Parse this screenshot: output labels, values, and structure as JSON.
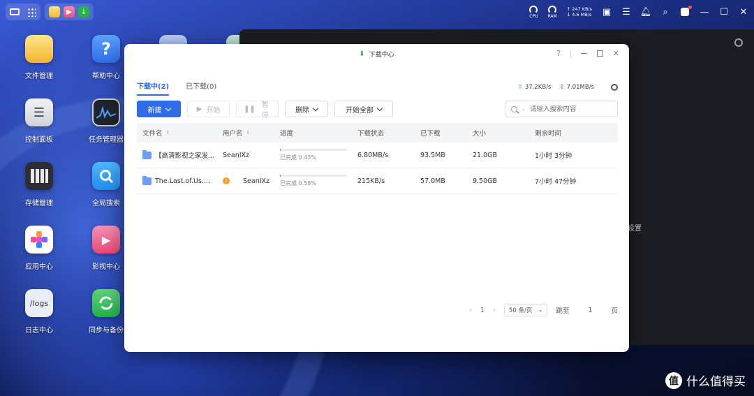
{
  "window": {
    "title": "下载中心",
    "help": "?",
    "close": "✕"
  },
  "tabs": [
    {
      "label": "下载中心(2)"
    },
    {
      "label": "已下载(0)"
    }
  ],
  "tabs_fix": [
    "下载中(2)",
    "已下载(0)"
  ],
  "speeds": {
    "upload": "37.2KB/s",
    "download": "7.01MB/s"
  },
  "toolbar": {
    "new_label": "新建",
    "start_label": "开始",
    "pause_label": "暂停",
    "delete_label": "删除",
    "start_all_label": "开始全部",
    "search_placeholder": "请输入搜索内容"
  },
  "table": {
    "headers": [
      "文件名",
      "用户名",
      "进度",
      "下载状态",
      "已下载",
      "大小",
      "剩余时间"
    ],
    "rows": [
      {
        "name": "【高清影视之家发...",
        "user": "SeanIXz",
        "progress": 0.43,
        "progress_text": "已完成 0.43%",
        "status": "6.80MB/s",
        "downloaded": "93.5MB",
        "size": "21.0GB",
        "remaining": "1小时 3分钟",
        "warning": false
      },
      {
        "name": "The.Last.of.Us....",
        "user": "SeanIXz",
        "progress": 0.58,
        "progress_text": "已完成 0.58%",
        "status": "215KB/s",
        "downloaded": "57.0MB",
        "size": "9.50GB",
        "remaining": "7小时 47分钟",
        "warning": true
      }
    ]
  },
  "pager": {
    "current": "1",
    "page_size": "50 条/页",
    "goto_label": "跳至",
    "goto_value": "1",
    "page_unit": "页"
  },
  "desktop": {
    "icons": [
      {
        "label": "文件管理",
        "glyph": ""
      },
      {
        "label": "帮助中心",
        "glyph": "?"
      },
      {
        "label": "控制面板",
        "glyph": ""
      },
      {
        "label": "任务管理器",
        "glyph": ""
      },
      {
        "label": "存储管理",
        "glyph": ""
      },
      {
        "label": "全局搜索",
        "glyph": ""
      },
      {
        "label": "应用中心",
        "glyph": ""
      },
      {
        "label": "影视中心",
        "glyph": "▶"
      },
      {
        "label": "日志中心",
        "glyph": "/logs"
      },
      {
        "label": "同步与备份",
        "glyph": ""
      }
    ]
  },
  "statusbar": {
    "cpu": "CPU",
    "ram": "RAM",
    "net_up": "↑ 247 KB/s",
    "net_down": "↓ 4.6 MB/s"
  },
  "background_window": {
    "text": "设置"
  },
  "watermark": {
    "logo": "值",
    "text": "什么值得买"
  },
  "colors": {
    "accent": "#2f6de8",
    "upload": "#23b24b",
    "warning": "#f2a11d"
  }
}
